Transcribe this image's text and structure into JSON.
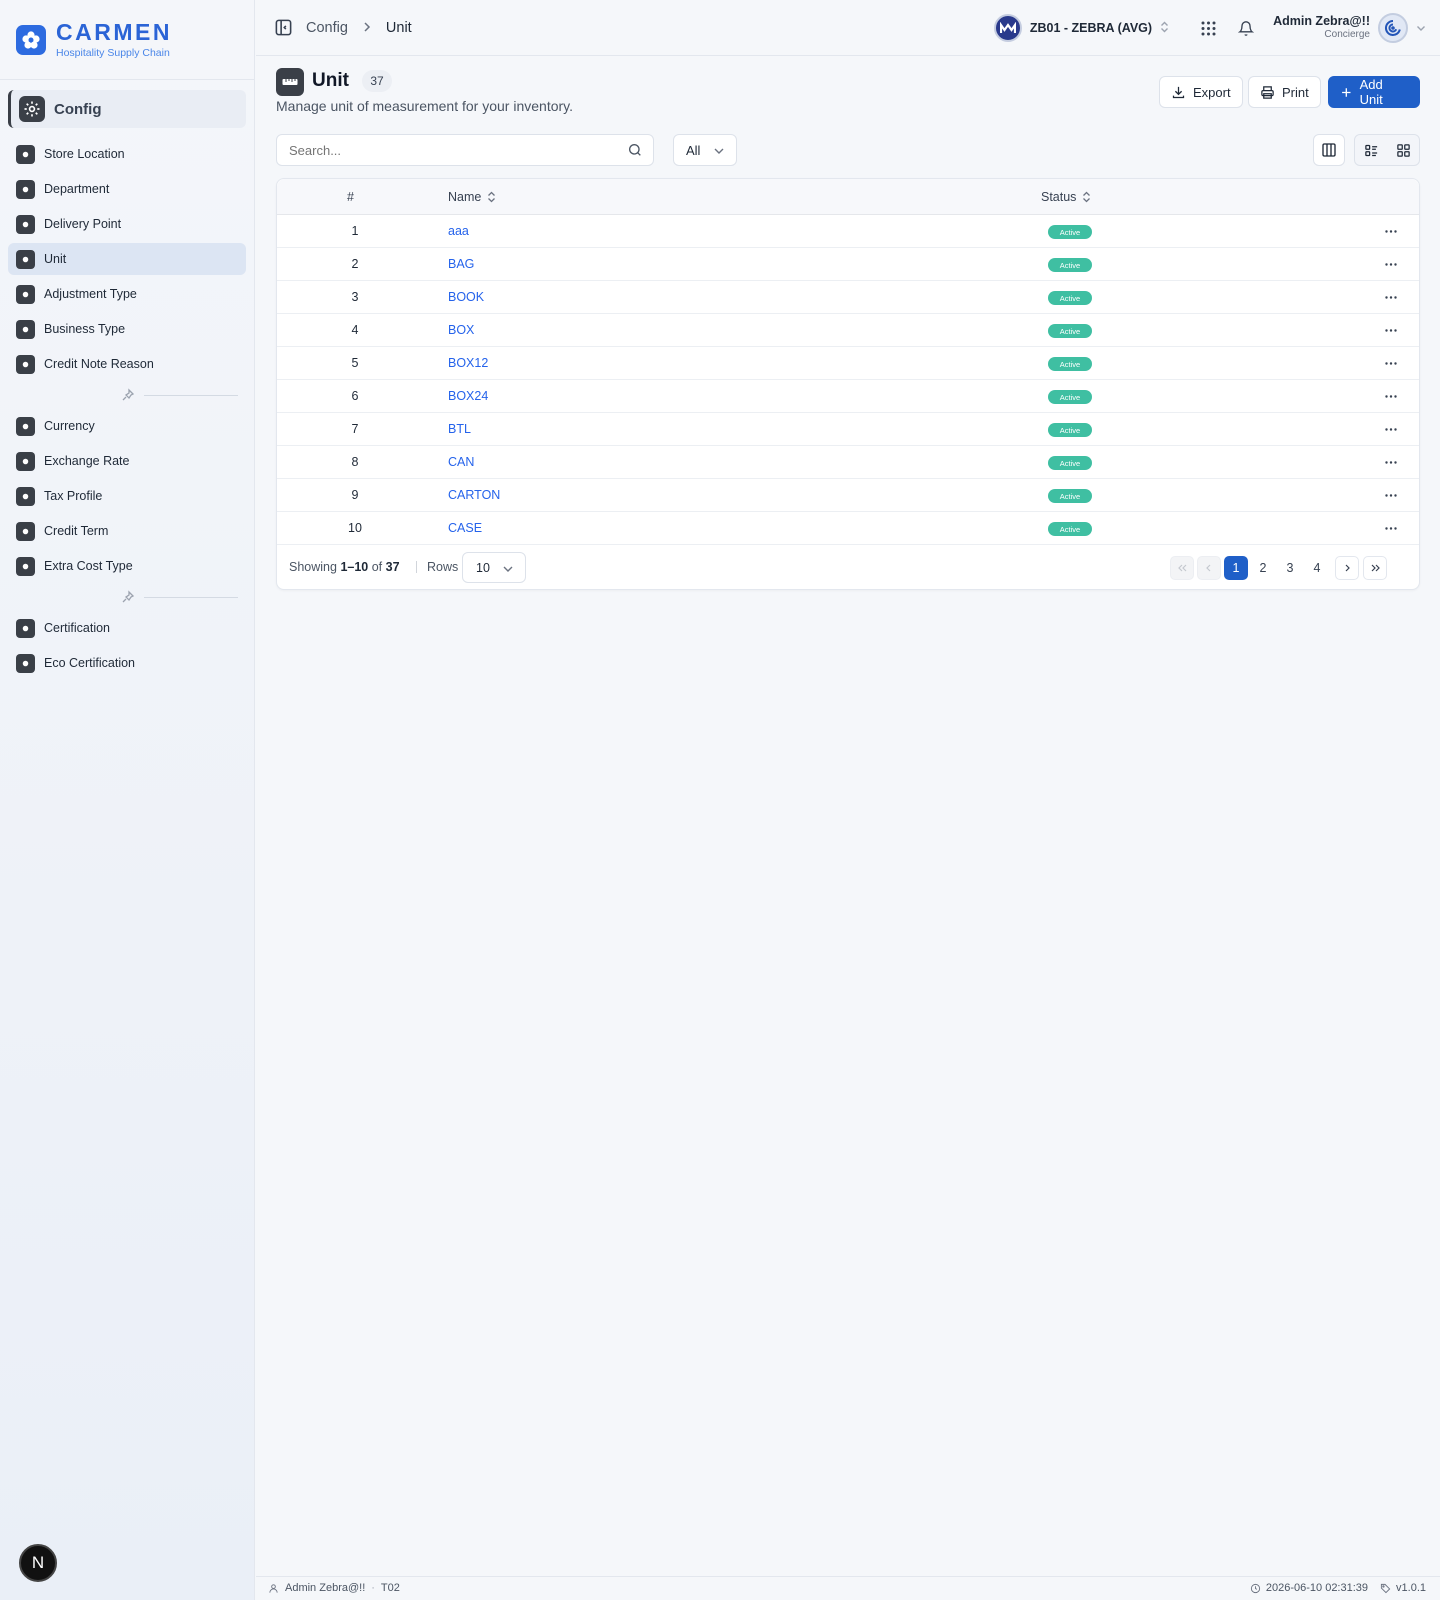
{
  "brand": {
    "title": "CARMEN",
    "subtitle": "Hospitality Supply Chain"
  },
  "sidebar": {
    "section_label": "Config",
    "groups": [
      [
        {
          "label": "Store Location",
          "icon": "map-pin-icon"
        },
        {
          "label": "Department",
          "icon": "building-icon"
        },
        {
          "label": "Delivery Point",
          "icon": "location-icon"
        },
        {
          "label": "Unit",
          "icon": "ruler-icon",
          "active": true
        },
        {
          "label": "Adjustment Type",
          "icon": "sliders-icon"
        },
        {
          "label": "Business Type",
          "icon": "briefcase-icon"
        },
        {
          "label": "Credit Note Reason",
          "icon": "message-icon"
        }
      ],
      [
        {
          "label": "Currency",
          "icon": "coin-icon"
        },
        {
          "label": "Exchange Rate",
          "icon": "exchange-icon"
        },
        {
          "label": "Tax Profile",
          "icon": "document-icon"
        },
        {
          "label": "Credit Term",
          "icon": "clock-icon"
        },
        {
          "label": "Extra Cost Type",
          "icon": "dots-icon"
        }
      ],
      [
        {
          "label": "Certification",
          "icon": "award-icon"
        },
        {
          "label": "Eco Certification",
          "icon": "leaf-icon"
        }
      ]
    ],
    "floating_badge": "N"
  },
  "topbar": {
    "breadcrumb": [
      "Config",
      "Unit"
    ],
    "org_name": "ZB01 - ZEBRA (AVG)",
    "user_name": "Admin Zebra@!!",
    "user_role": "Concierge"
  },
  "page": {
    "title": "Unit",
    "count": "37",
    "description": "Manage unit of measurement for your inventory.",
    "export_label": "Export",
    "print_label": "Print",
    "add_label": "Add Unit"
  },
  "filters": {
    "search_placeholder": "Search...",
    "status_value": "All"
  },
  "table": {
    "columns": [
      "#",
      "Name",
      "Status"
    ],
    "rows": [
      {
        "num": "1",
        "name": "aaa",
        "status": "Active"
      },
      {
        "num": "2",
        "name": "BAG",
        "status": "Active"
      },
      {
        "num": "3",
        "name": "BOOK",
        "status": "Active"
      },
      {
        "num": "4",
        "name": "BOX",
        "status": "Active"
      },
      {
        "num": "5",
        "name": "BOX12",
        "status": "Active"
      },
      {
        "num": "6",
        "name": "BOX24",
        "status": "Active"
      },
      {
        "num": "7",
        "name": "BTL",
        "status": "Active"
      },
      {
        "num": "8",
        "name": "CAN",
        "status": "Active"
      },
      {
        "num": "9",
        "name": "CARTON",
        "status": "Active"
      },
      {
        "num": "10",
        "name": "CASE",
        "status": "Active"
      }
    ]
  },
  "pagination": {
    "showing_prefix": "Showing",
    "range": "1–10",
    "of_label": "of",
    "total": "37",
    "rows_label": "Rows",
    "rows_value": "10",
    "pages": [
      "1",
      "2",
      "3",
      "4"
    ],
    "current_page": "1"
  },
  "statusbar": {
    "user": "Admin Zebra@!!",
    "separator": "·",
    "tenant": "T02",
    "datetime": "2026-06-10 02:31:39",
    "version": "v1.0.1"
  },
  "colors": {
    "primary": "#1f5fc8",
    "brand": "#2b64d6",
    "link": "#2563eb",
    "active_badge": "#3fbfa2"
  }
}
